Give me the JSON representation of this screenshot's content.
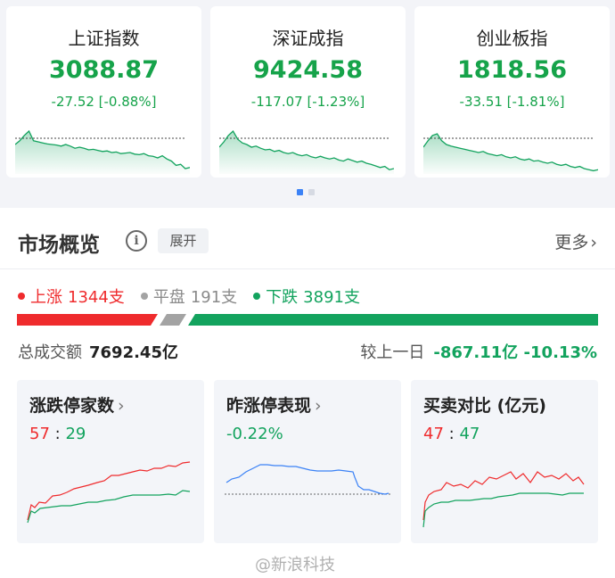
{
  "indices": [
    {
      "name": "上证指数",
      "value": "3088.87",
      "change": "-27.52 [-0.88%]",
      "spark": [
        0.55,
        0.62,
        0.72,
        0.8,
        0.62,
        0.6,
        0.58,
        0.56,
        0.55,
        0.54,
        0.52,
        0.55,
        0.52,
        0.48,
        0.5,
        0.48,
        0.45,
        0.46,
        0.44,
        0.42,
        0.43,
        0.4,
        0.41,
        0.38,
        0.39,
        0.4,
        0.37,
        0.36,
        0.38,
        0.34,
        0.33,
        0.3,
        0.34,
        0.28,
        0.24,
        0.16,
        0.18,
        0.1,
        0.12
      ]
    },
    {
      "name": "深证成指",
      "value": "9424.58",
      "change": "-117.07 [-1.23%]",
      "spark": [
        0.5,
        0.6,
        0.72,
        0.8,
        0.65,
        0.58,
        0.55,
        0.5,
        0.52,
        0.48,
        0.45,
        0.46,
        0.42,
        0.44,
        0.4,
        0.38,
        0.4,
        0.36,
        0.34,
        0.36,
        0.32,
        0.3,
        0.33,
        0.3,
        0.28,
        0.3,
        0.26,
        0.24,
        0.28,
        0.25,
        0.22,
        0.24,
        0.2,
        0.18,
        0.15,
        0.12,
        0.14,
        0.08,
        0.1
      ]
    },
    {
      "name": "创业板指",
      "value": "1818.56",
      "change": "-33.51 [-1.81%]",
      "spark": [
        0.5,
        0.62,
        0.72,
        0.75,
        0.62,
        0.55,
        0.52,
        0.5,
        0.48,
        0.46,
        0.44,
        0.42,
        0.4,
        0.42,
        0.38,
        0.36,
        0.34,
        0.36,
        0.32,
        0.3,
        0.32,
        0.28,
        0.26,
        0.28,
        0.24,
        0.25,
        0.22,
        0.2,
        0.22,
        0.18,
        0.16,
        0.18,
        0.14,
        0.12,
        0.14,
        0.1,
        0.08,
        0.06,
        0.08
      ]
    }
  ],
  "market": {
    "title": "市场概览",
    "info_icon": "ⓘ",
    "expand_label": "展开",
    "more_label": "更多",
    "more_icon": "chevron-right-icon",
    "breadth": {
      "up_label": "上涨",
      "up_count": "1344支",
      "flat_label": "平盘",
      "flat_count": "191支",
      "down_label": "下跌",
      "down_count": "3891支"
    },
    "volume_label": "总成交额",
    "volume_value": "7692.45亿",
    "compare_label": "较上一日",
    "compare_value": "-867.11亿 -10.13%"
  },
  "cards": [
    {
      "title": "涨跌停家数",
      "has_chevron": true,
      "value_a": "57",
      "value_b": "29",
      "sep": ":"
    },
    {
      "title": "昨涨停表现",
      "has_chevron": true,
      "value": "-0.22%"
    },
    {
      "title": "买卖对比 (亿元)",
      "has_chevron": false,
      "value_a": "47",
      "value_b": "47",
      "sep": ":"
    }
  ],
  "colors": {
    "up": "#ef2b2d",
    "down": "#13a35e",
    "flat": "#a3a3a3",
    "blue": "#3b82f6"
  },
  "watermark": "@新浪科技"
}
